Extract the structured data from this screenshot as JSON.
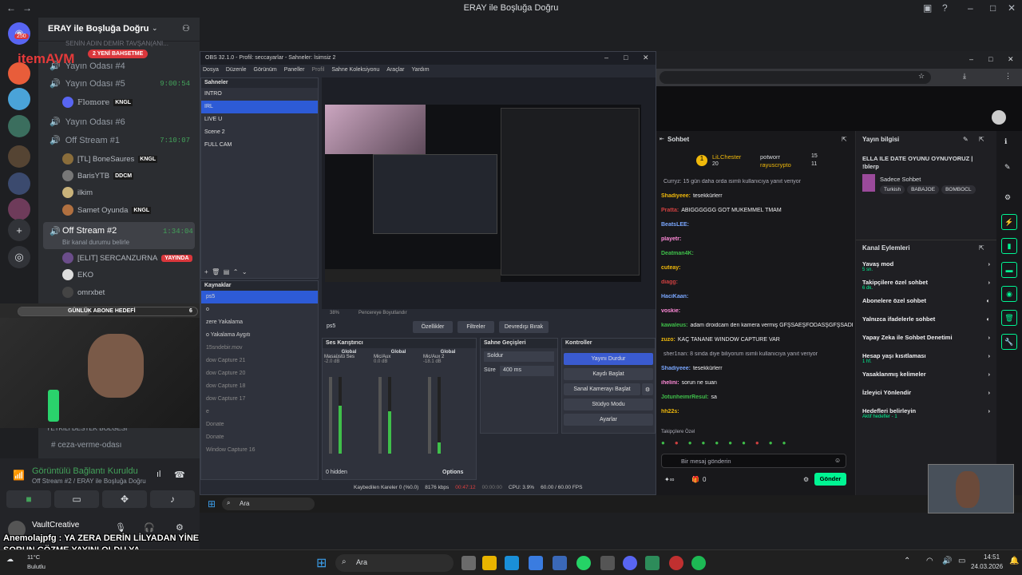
{
  "window": {
    "title": "ERAY ile Boşluğa Doğru"
  },
  "server": {
    "name": "ERAY ile Boşluğa Doğru",
    "pinned_top": "SENİN ADIN DEMİR TAVŞAN(ANI...",
    "new_pill": "2 YENİ BAHSETME"
  },
  "rail": {
    "badge": "250"
  },
  "channels": [
    {
      "name": "Yayın Odası #4",
      "time": ""
    },
    {
      "name": "Yayın Odası #5",
      "time": "9:00:54"
    },
    {
      "name": "Yayın Odası #6",
      "time": ""
    },
    {
      "name": "Off Stream #1",
      "time": "7:10:07"
    },
    {
      "name": "Off Stream #2",
      "time": "1:34:04"
    }
  ],
  "users": {
    "flomore": "Flomore",
    "bonesaures": "[TL] BoneSaures",
    "baris": "BarisYTB",
    "ilkim": "ilkim",
    "samet": "Samet Oyunda",
    "sercan": "[ELIT] SERCANZURNA",
    "eko": "EKO",
    "omrx": "omrxbet"
  },
  "badges": {
    "kngl": "KNGL",
    "ddcm": "DDCM",
    "yayinda": "YAYINDA"
  },
  "status_hint": "Bir kanal durumu belirle",
  "sub_goal": {
    "label": "GÜNLÜK ABONE HEDEFİ",
    "count": "6"
  },
  "lower_channels": {
    "cat": "YETKİLİ DESTEK BÖLGESİ",
    "ch": "ceza-verme-odası"
  },
  "voice": {
    "status": "Görüntülü Bağlantı Kuruldu",
    "where": "Off Stream #2 / ERAY ile Boşluğa Doğru"
  },
  "user": {
    "name": "VaultCreative"
  },
  "overlay_text": "Anemolajpfg : YA ZERA DERİN LİLYADAN YİNE SORUN ÇÖZME YAYINI OLDU YA",
  "weather": {
    "temp": "11°C",
    "desc": "Bulutlu"
  },
  "brand": "itemAVM",
  "obs": {
    "title": "OBS 32.1.0 - Profil: seccayarlar - Sahneler: İsimsiz 2",
    "menu": [
      "Dosya",
      "Düzenle",
      "Görünüm",
      "Paneller",
      "Profil",
      "Sahne Koleksiyonu",
      "Araçlar",
      "Yardım"
    ],
    "scenes_title": "Sahneler",
    "scenes": [
      "INTRO",
      "IRL",
      "LIVE U",
      "Scene 2",
      "FULL CAM"
    ],
    "sources_title": "Kaynaklar",
    "sources": [
      "ps5",
      "o",
      "zere Yakalama",
      "o Yakalama Aygıtı",
      "15sndebir.mov",
      "dow Capture 21",
      "dow Capture 20",
      "dow Capture 18",
      "dow Capture 17",
      "e",
      "Donate",
      "Donate",
      "Window Capture 16"
    ],
    "source_selected": "ps5",
    "props": "Özellikler",
    "filters": "Filtreler",
    "deactivate": "Devredışı Bırak",
    "mixer_title": "Ses Karıştırıcı",
    "mixer": [
      {
        "scope": "Global",
        "name": "Masaüstü Ses",
        "db": "-2.0 dB",
        "level": 0.62
      },
      {
        "scope": "Global",
        "name": "Mic/Aux",
        "db": "0.0 dB",
        "level": 0.55
      },
      {
        "scope": "Global",
        "name": "Mic/Aux 2",
        "db": "-18.1 dB",
        "level": 0.15
      }
    ],
    "hidden": "0 hidden",
    "options": "Options",
    "transitions_title": "Sahne Geçişleri",
    "transition": "Soldur",
    "duration_label": "Süre",
    "duration": "400 ms",
    "controls_title": "Kontroller",
    "controls": [
      "Yayını Durdur",
      "Kaydı Başlat",
      "Sanal Kamerayı Başlat",
      "Stüdyo Modu",
      "Ayarlar"
    ],
    "status": {
      "dropped": "Kaybedilen Kareler 0 (%0.0)",
      "kbps": "8176 kbps",
      "live_time": "00:47:12",
      "rec_time": "00:00:00",
      "cpu": "CPU: 3.9%",
      "fps": "60.00 / 60.00 FPS"
    },
    "zoom": "38%",
    "preview_hint": "Pencereye Boyutlandır"
  },
  "twitch": {
    "chat_title": "Sohbet",
    "top": [
      {
        "name": "LiLChester",
        "value": "20"
      },
      {
        "name": "potworr",
        "value": "15"
      },
      {
        "name": "rayuscrypto",
        "value": "11"
      }
    ],
    "messages": [
      {
        "user": "",
        "text": "Curryz: 15 gün daha orda isimli kullanıcıya yanıt veriyor"
      },
      {
        "user": "Shadiyeee:",
        "text": "tesekkürlerr"
      },
      {
        "user": "Pratta:",
        "text": "ABIGGGGGG GOT MUKEMMEL TMAM"
      },
      {
        "user": "BeatsLEE:",
        "text": ""
      },
      {
        "user": "playetr:",
        "text": ""
      },
      {
        "user": "Deatman4K:",
        "text": ""
      },
      {
        "user": "cuteay:",
        "text": ""
      },
      {
        "user": "diagg:",
        "text": ""
      },
      {
        "user": "HaciKaan:",
        "text": ""
      },
      {
        "user": "voskie:",
        "text": ""
      },
      {
        "user": "kawaleus:",
        "text": "adam droidcam den kamera vermiş ĞFŞSAEŞFÖDASŞĞFŞSADF"
      },
      {
        "user": "zuzo:",
        "text": "KAÇ TANANE WINDOW CAPTURE VAR"
      },
      {
        "user": "",
        "text": "sher1nan: 8 sinda diye biliyorum isimli kullanıcıya yanıt veriyor"
      },
      {
        "user": "Shadiyeee:",
        "text": "tesekkürlerr"
      },
      {
        "user": "ihelini:",
        "text": "sorun ne suan"
      },
      {
        "user": "JotunheimrResul:",
        "text": "sa"
      },
      {
        "user": "hh22s:",
        "text": ""
      }
    ],
    "vip_label": "Takipçilere Özel",
    "input_placeholder": "Bir mesaj gönderin",
    "send": "Gönder",
    "points": "0",
    "info_title": "Yayın bilgisi",
    "stream_title": "ELLA ILE DATE OYUNU OYNUYORUZ | !blerp",
    "category": "Sadece Sohbet",
    "tags": [
      "Turkish",
      "BABAJOE",
      "BOMBOCL"
    ],
    "mod_title": "Kanal Eylemleri",
    "mod_actions": [
      {
        "label": "Yavaş mod",
        "sub": "5 sn."
      },
      {
        "label": "Takipçilere özel sohbet",
        "sub": "6 dk."
      },
      {
        "label": "Abonelere özel sohbet",
        "sub": ""
      },
      {
        "label": "Yalnızca ifadelerle sohbet",
        "sub": ""
      },
      {
        "label": "Yapay Zeka ile Sohbet Denetimi",
        "sub": ""
      },
      {
        "label": "Hesap yaşı kısıtlaması",
        "sub": "1 hf."
      },
      {
        "label": "Yasaklanmış kelimeler",
        "sub": ""
      },
      {
        "label": "İzleyici Yönlendir",
        "sub": ""
      },
      {
        "label": "Hedefleri belirleyin",
        "sub": "Aktif hedefler - 1"
      }
    ]
  },
  "taskbar": {
    "search": "Ara",
    "time": "14:51",
    "date": "24.03.2026",
    "inner_search": "Ara"
  }
}
